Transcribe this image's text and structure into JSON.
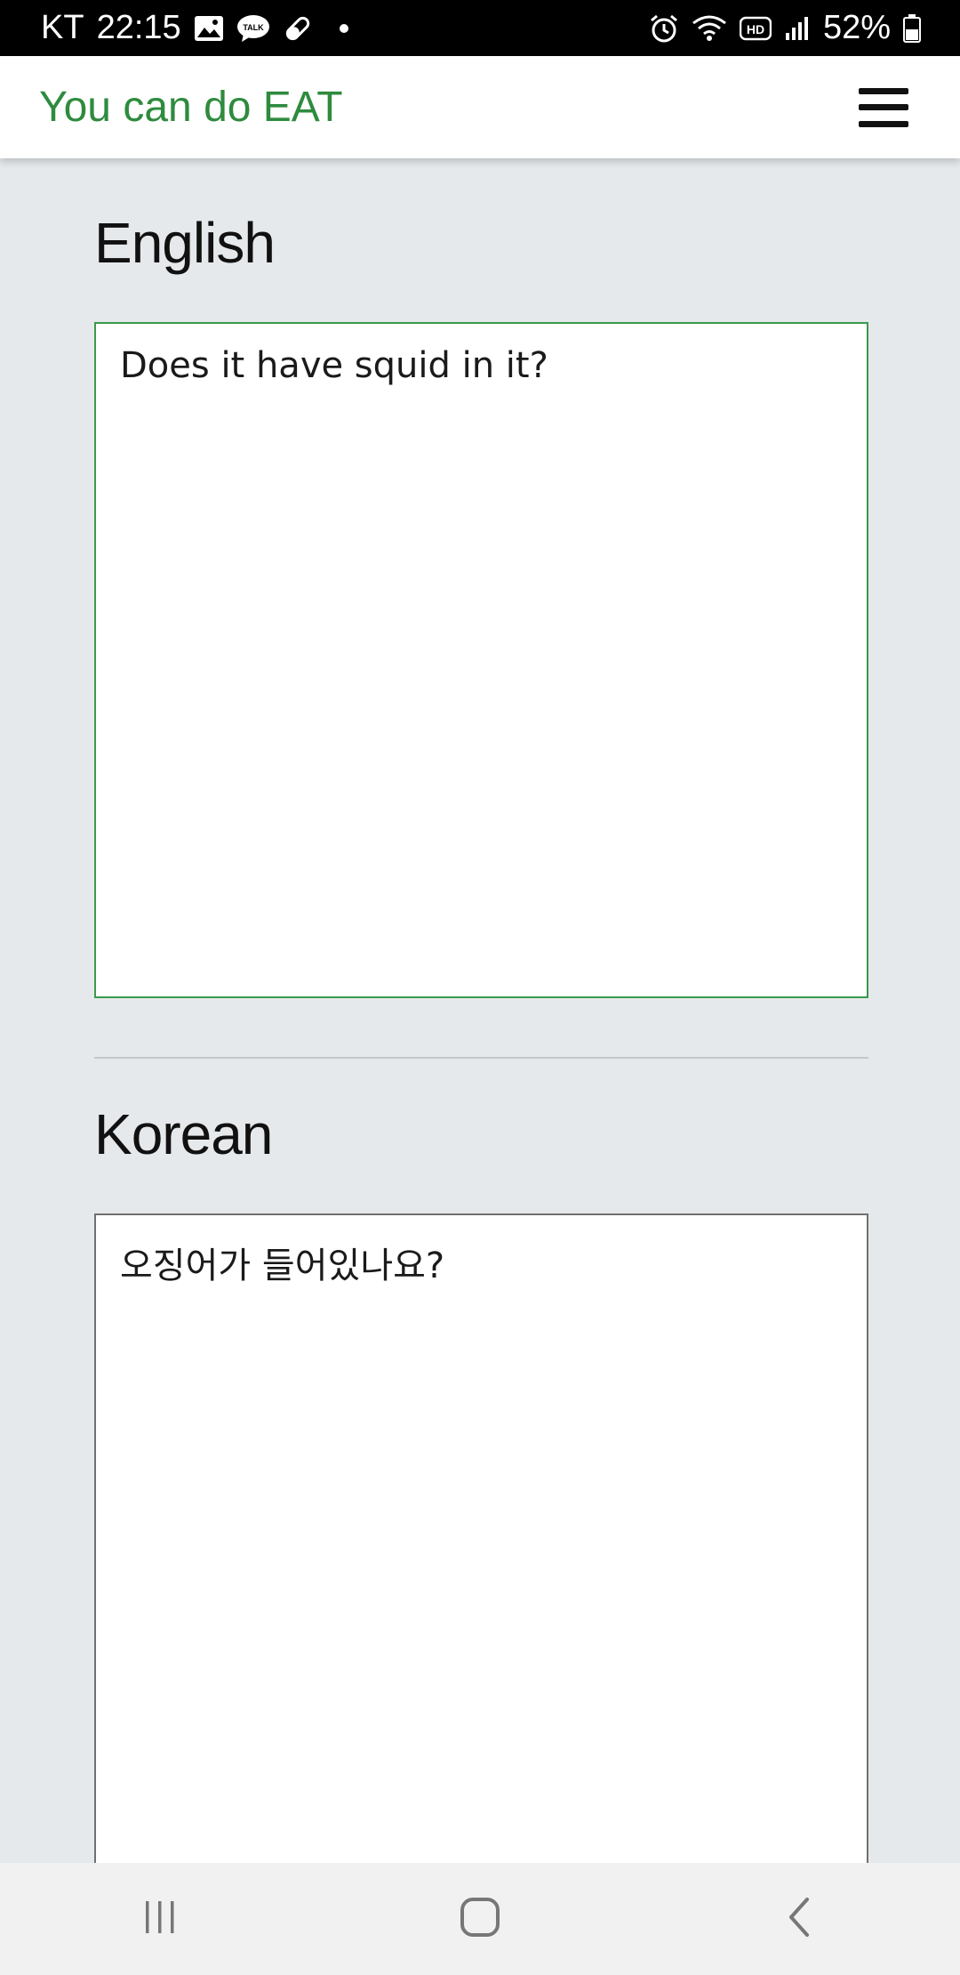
{
  "status_bar": {
    "carrier": "KT",
    "time": "22:15",
    "battery": "52%"
  },
  "header": {
    "brand": "You can do EAT"
  },
  "sections": {
    "english": {
      "title": "English",
      "text": "Does it have squid in it?"
    },
    "korean": {
      "title": "Korean",
      "text": "오징어가 들어있나요?"
    }
  },
  "colors": {
    "brand": "#2e8b3e",
    "active_border": "#3a9a4a",
    "background": "#e6e9ec"
  },
  "icons": {
    "status_left": [
      "gallery-icon",
      "talk-icon",
      "pill-icon",
      "notification-dot-icon"
    ],
    "status_right": [
      "alarm-icon",
      "wifi-icon",
      "hd-icon",
      "signal-icon",
      "battery-icon"
    ],
    "nav": [
      "recent-apps-icon",
      "home-icon",
      "back-icon"
    ]
  }
}
